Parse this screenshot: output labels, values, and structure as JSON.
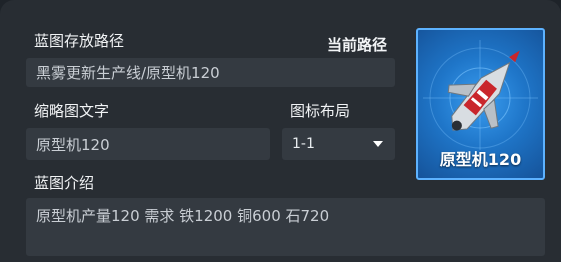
{
  "path_section": {
    "label": "蓝图存放路径",
    "current_path_label": "当前路径",
    "value": "黑雾更新生产线/原型机120"
  },
  "thumbnail_text_section": {
    "label": "缩略图文字",
    "value": "原型机120"
  },
  "icon_layout_section": {
    "label": "图标布局",
    "selected": "1-1"
  },
  "description_section": {
    "label": "蓝图介绍",
    "value": "原型机产量120 需求 铁1200 铜600 石720"
  },
  "thumbnail": {
    "caption": "原型机120",
    "icon": "drone-ship-icon",
    "background_color": "#1f76c9"
  }
}
